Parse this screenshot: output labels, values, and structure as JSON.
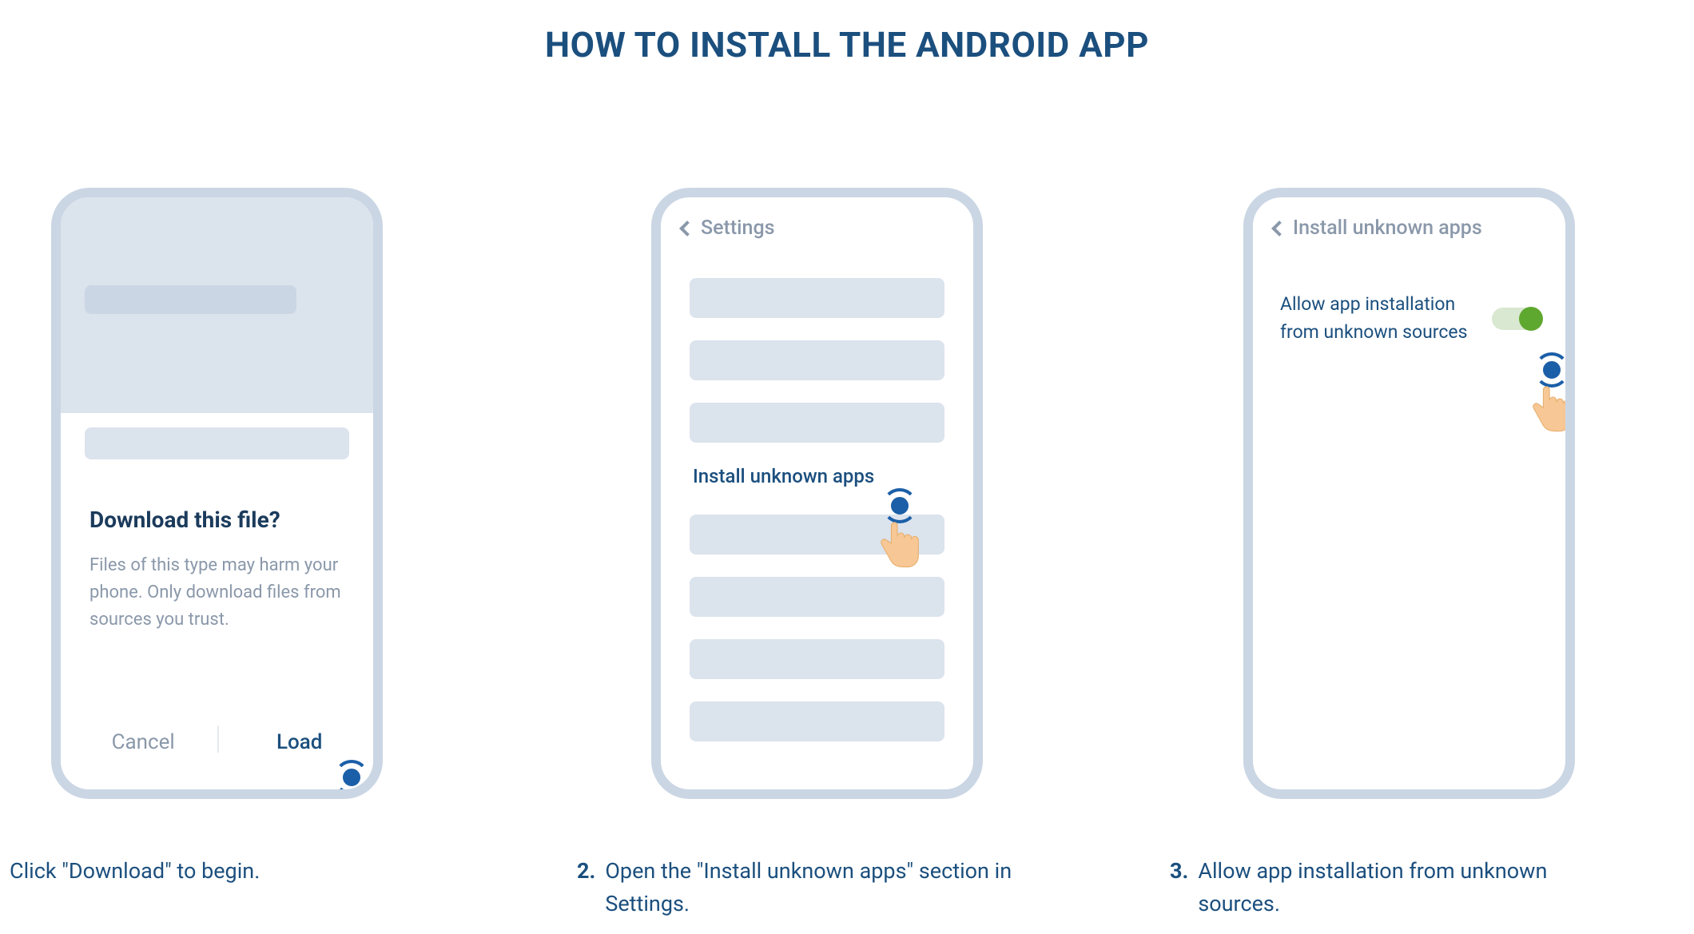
{
  "title": "HOW TO INSTALL THE ANDROID APP",
  "step1": {
    "sheet_title": "Download this file?",
    "sheet_body": "Files of this type may harm your phone. Only download files from sources you trust.",
    "cancel": "Cancel",
    "load": "Load",
    "caption_num": "",
    "caption": "Click \"Download\" to begin."
  },
  "step2": {
    "header": "Settings",
    "item_label": "Install unknown apps",
    "caption_num": "2.",
    "caption": "Open the \"Install unknown apps\" section in Settings."
  },
  "step3": {
    "header": "Install unknown apps",
    "toggle_label": "Allow app installation from unknown sources",
    "caption_num": "3.",
    "caption": "Allow app installation from unknown sources."
  },
  "colors": {
    "brand": "#1b4f7e",
    "muted": "#8a98aa",
    "frame": "#cbd6e4",
    "placeholder": "#dbe3ed",
    "toggle_on": "#5fa82f"
  }
}
